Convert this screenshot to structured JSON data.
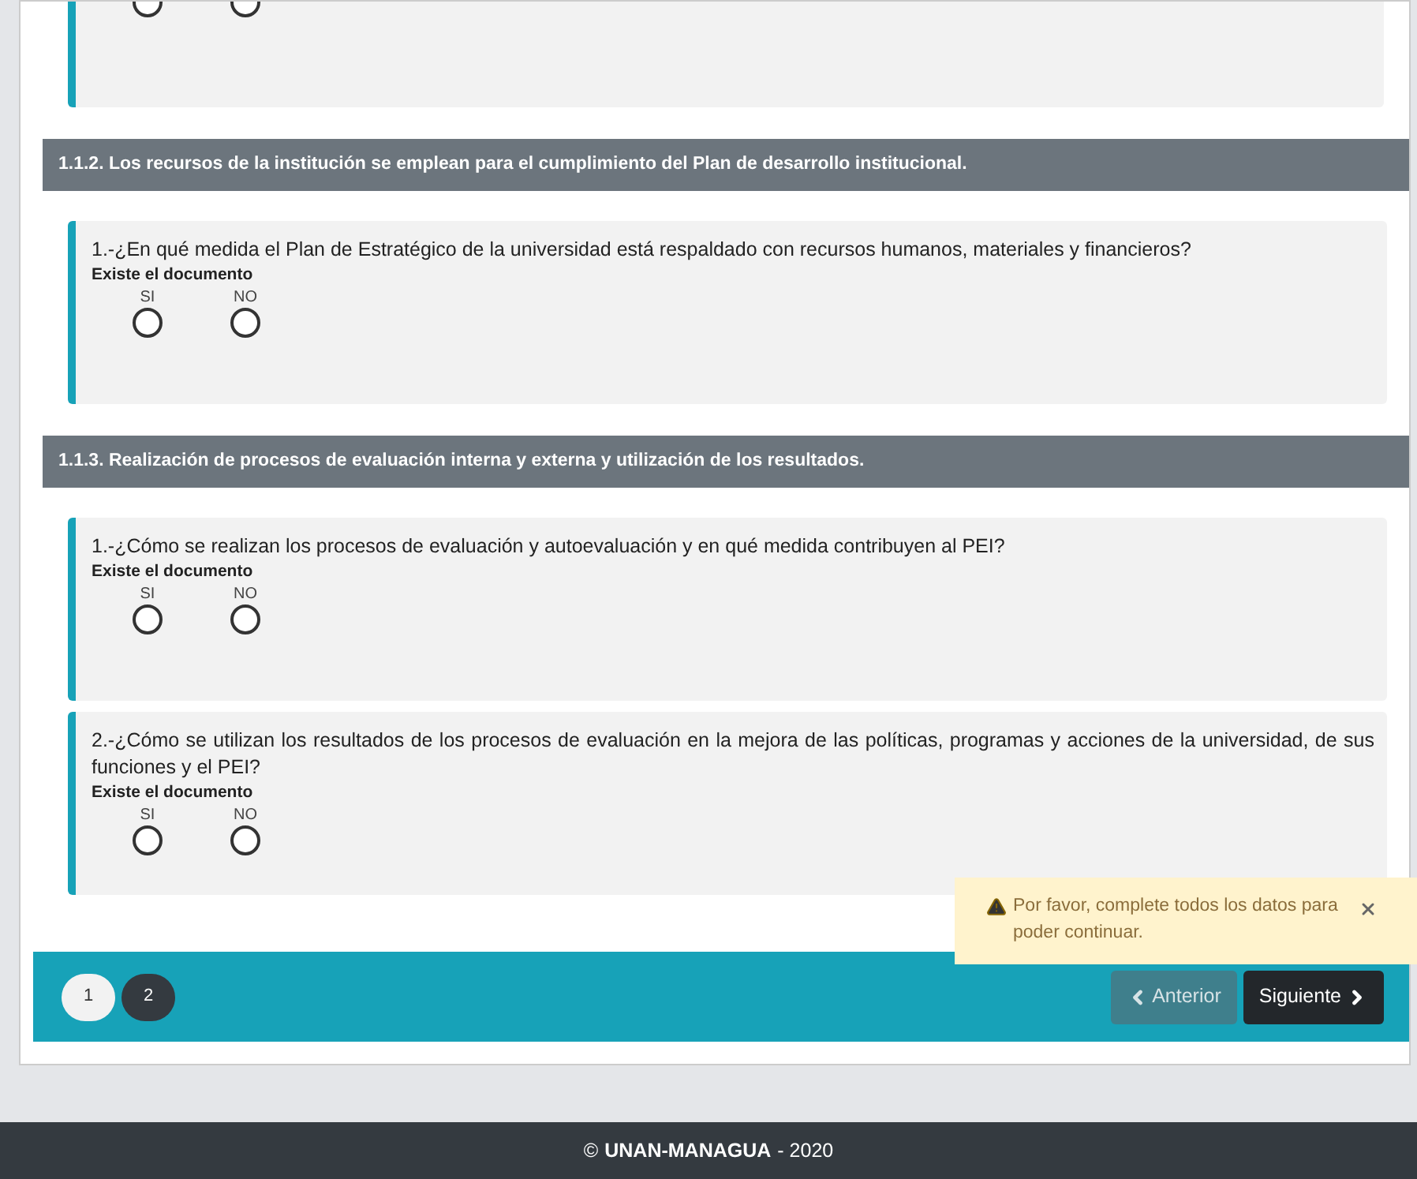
{
  "partial_question": {
    "options": [
      {
        "selected": false
      },
      {
        "selected": false
      }
    ]
  },
  "sections": [
    {
      "title": "1.1.2. Los recursos de la institución se emplean para el cumplimiento del Plan de desarrollo institucional.",
      "questions": [
        {
          "text": "1.-¿En qué medida el Plan de Estratégico de la universidad está respaldado con recursos humanos, materiales y financieros?",
          "sublabel": "Existe el documento",
          "options": [
            {
              "label": "SI",
              "selected": false
            },
            {
              "label": "NO",
              "selected": false
            }
          ]
        }
      ]
    },
    {
      "title": "1.1.3. Realización de procesos de evaluación interna y externa y utilización de los resultados.",
      "questions": [
        {
          "text": "1.-¿Cómo se realizan los procesos de evaluación y autoevaluación y en qué medida contribuyen al PEI?",
          "sublabel": "Existe el documento",
          "options": [
            {
              "label": "SI",
              "selected": false
            },
            {
              "label": "NO",
              "selected": false
            }
          ]
        },
        {
          "text": "2.-¿Cómo se utilizan los resultados de los procesos de evaluación en la mejora de las políticas, programas y acciones de la universidad, de sus funciones y el PEI?",
          "sublabel": "Existe el documento",
          "options": [
            {
              "label": "SI",
              "selected": false
            },
            {
              "label": "NO",
              "selected": false
            }
          ]
        }
      ]
    }
  ],
  "toast": {
    "message": "Por favor, complete todos los datos para poder continuar."
  },
  "pagination": [
    {
      "label": "1",
      "selected": true
    },
    {
      "label": "2",
      "selected": false
    }
  ],
  "buttons": {
    "previous": "Anterior",
    "next": "Siguiente"
  },
  "footer": {
    "symbol": "©",
    "brand": "UNAN-MANAGUA",
    "year": "- 2020"
  }
}
